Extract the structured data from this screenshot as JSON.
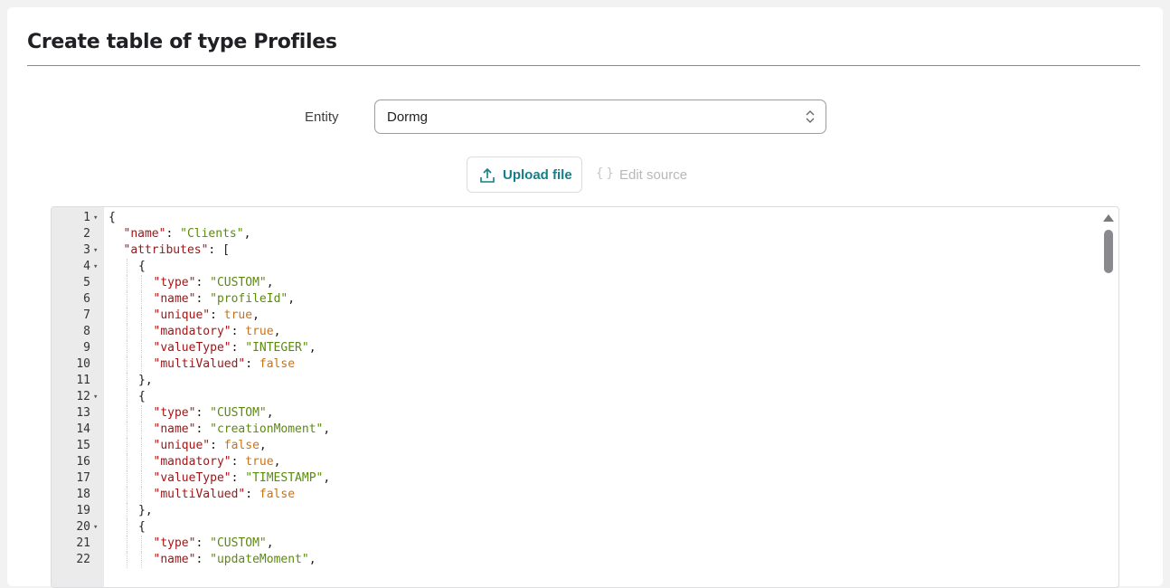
{
  "page": {
    "title": "Create table of type Profiles"
  },
  "form": {
    "entity_label": "Entity",
    "entity_value": "Dormg"
  },
  "actions": {
    "upload_label": "Upload file",
    "upload_icon": "upload-icon",
    "edit_label": "Edit source",
    "edit_icon": "braces-icon"
  },
  "colors": {
    "accent": "#137f86",
    "key": "#a31515",
    "string": "#5b8a0f",
    "boolean": "#c8721a"
  },
  "editor": {
    "lines": [
      {
        "n": "1",
        "fold": true,
        "indent": 0,
        "tokens": [
          {
            "t": "p",
            "v": "{"
          }
        ]
      },
      {
        "n": "2",
        "fold": false,
        "indent": 1,
        "tokens": [
          {
            "t": "k",
            "v": "\"name\""
          },
          {
            "t": "p",
            "v": ": "
          },
          {
            "t": "s",
            "v": "\"Clients\""
          },
          {
            "t": "p",
            "v": ","
          }
        ]
      },
      {
        "n": "3",
        "fold": true,
        "indent": 1,
        "tokens": [
          {
            "t": "k",
            "v": "\"attributes\""
          },
          {
            "t": "p",
            "v": ": ["
          }
        ]
      },
      {
        "n": "4",
        "fold": true,
        "indent": 2,
        "tokens": [
          {
            "t": "p",
            "v": "{"
          }
        ]
      },
      {
        "n": "5",
        "fold": false,
        "indent": 3,
        "tokens": [
          {
            "t": "k",
            "v": "\"type\""
          },
          {
            "t": "p",
            "v": ": "
          },
          {
            "t": "s",
            "v": "\"CUSTOM\""
          },
          {
            "t": "p",
            "v": ","
          }
        ]
      },
      {
        "n": "6",
        "fold": false,
        "indent": 3,
        "tokens": [
          {
            "t": "k",
            "v": "\"name\""
          },
          {
            "t": "p",
            "v": ": "
          },
          {
            "t": "s",
            "v": "\"profileId\""
          },
          {
            "t": "p",
            "v": ","
          }
        ]
      },
      {
        "n": "7",
        "fold": false,
        "indent": 3,
        "tokens": [
          {
            "t": "k",
            "v": "\"unique\""
          },
          {
            "t": "p",
            "v": ": "
          },
          {
            "t": "b",
            "v": "true"
          },
          {
            "t": "p",
            "v": ","
          }
        ]
      },
      {
        "n": "8",
        "fold": false,
        "indent": 3,
        "tokens": [
          {
            "t": "k",
            "v": "\"mandatory\""
          },
          {
            "t": "p",
            "v": ": "
          },
          {
            "t": "b",
            "v": "true"
          },
          {
            "t": "p",
            "v": ","
          }
        ]
      },
      {
        "n": "9",
        "fold": false,
        "indent": 3,
        "tokens": [
          {
            "t": "k",
            "v": "\"valueType\""
          },
          {
            "t": "p",
            "v": ": "
          },
          {
            "t": "s",
            "v": "\"INTEGER\""
          },
          {
            "t": "p",
            "v": ","
          }
        ]
      },
      {
        "n": "10",
        "fold": false,
        "indent": 3,
        "tokens": [
          {
            "t": "k",
            "v": "\"multiValued\""
          },
          {
            "t": "p",
            "v": ": "
          },
          {
            "t": "b",
            "v": "false"
          }
        ]
      },
      {
        "n": "11",
        "fold": false,
        "indent": 2,
        "tokens": [
          {
            "t": "p",
            "v": "},"
          }
        ]
      },
      {
        "n": "12",
        "fold": true,
        "indent": 2,
        "tokens": [
          {
            "t": "p",
            "v": "{"
          }
        ]
      },
      {
        "n": "13",
        "fold": false,
        "indent": 3,
        "tokens": [
          {
            "t": "k",
            "v": "\"type\""
          },
          {
            "t": "p",
            "v": ": "
          },
          {
            "t": "s",
            "v": "\"CUSTOM\""
          },
          {
            "t": "p",
            "v": ","
          }
        ]
      },
      {
        "n": "14",
        "fold": false,
        "indent": 3,
        "tokens": [
          {
            "t": "k",
            "v": "\"name\""
          },
          {
            "t": "p",
            "v": ": "
          },
          {
            "t": "s",
            "v": "\"creationMoment\""
          },
          {
            "t": "p",
            "v": ","
          }
        ]
      },
      {
        "n": "15",
        "fold": false,
        "indent": 3,
        "tokens": [
          {
            "t": "k",
            "v": "\"unique\""
          },
          {
            "t": "p",
            "v": ": "
          },
          {
            "t": "b",
            "v": "false"
          },
          {
            "t": "p",
            "v": ","
          }
        ]
      },
      {
        "n": "16",
        "fold": false,
        "indent": 3,
        "tokens": [
          {
            "t": "k",
            "v": "\"mandatory\""
          },
          {
            "t": "p",
            "v": ": "
          },
          {
            "t": "b",
            "v": "true"
          },
          {
            "t": "p",
            "v": ","
          }
        ]
      },
      {
        "n": "17",
        "fold": false,
        "indent": 3,
        "tokens": [
          {
            "t": "k",
            "v": "\"valueType\""
          },
          {
            "t": "p",
            "v": ": "
          },
          {
            "t": "s",
            "v": "\"TIMESTAMP\""
          },
          {
            "t": "p",
            "v": ","
          }
        ]
      },
      {
        "n": "18",
        "fold": false,
        "indent": 3,
        "tokens": [
          {
            "t": "k",
            "v": "\"multiValued\""
          },
          {
            "t": "p",
            "v": ": "
          },
          {
            "t": "b",
            "v": "false"
          }
        ]
      },
      {
        "n": "19",
        "fold": false,
        "indent": 2,
        "tokens": [
          {
            "t": "p",
            "v": "},"
          }
        ]
      },
      {
        "n": "20",
        "fold": true,
        "indent": 2,
        "tokens": [
          {
            "t": "p",
            "v": "{"
          }
        ]
      },
      {
        "n": "21",
        "fold": false,
        "indent": 3,
        "tokens": [
          {
            "t": "k",
            "v": "\"type\""
          },
          {
            "t": "p",
            "v": ": "
          },
          {
            "t": "s",
            "v": "\"CUSTOM\""
          },
          {
            "t": "p",
            "v": ","
          }
        ]
      },
      {
        "n": "22",
        "fold": false,
        "indent": 3,
        "tokens": [
          {
            "t": "k",
            "v": "\"name\""
          },
          {
            "t": "p",
            "v": ": "
          },
          {
            "t": "s",
            "v": "\"updateMoment\""
          },
          {
            "t": "p",
            "v": ","
          }
        ]
      }
    ]
  }
}
